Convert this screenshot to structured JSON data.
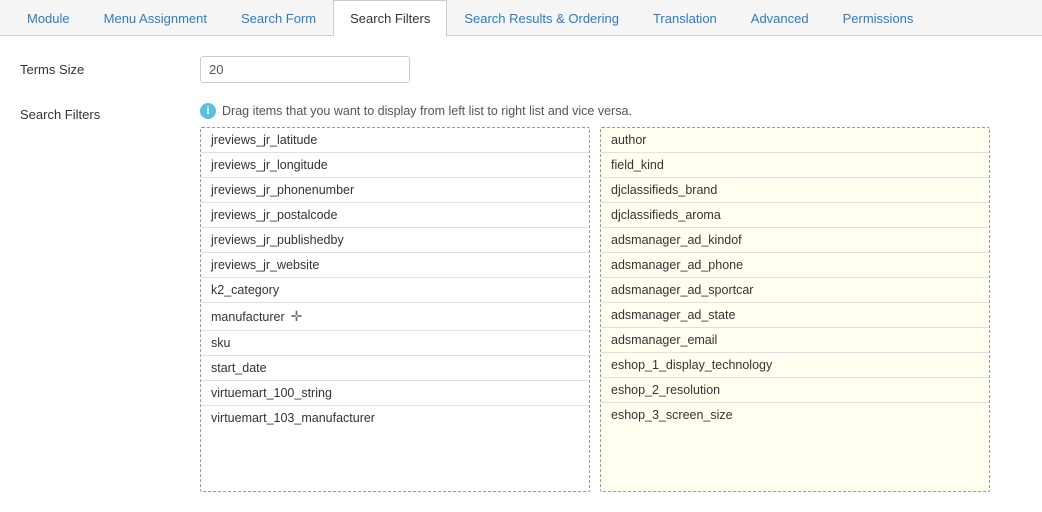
{
  "tabs": [
    {
      "id": "module",
      "label": "Module",
      "active": false
    },
    {
      "id": "menu-assignment",
      "label": "Menu Assignment",
      "active": false
    },
    {
      "id": "search-form",
      "label": "Search Form",
      "active": false
    },
    {
      "id": "search-filters",
      "label": "Search Filters",
      "active": true
    },
    {
      "id": "search-results-ordering",
      "label": "Search Results & Ordering",
      "active": false
    },
    {
      "id": "translation",
      "label": "Translation",
      "active": false
    },
    {
      "id": "advanced",
      "label": "Advanced",
      "active": false
    },
    {
      "id": "permissions",
      "label": "Permissions",
      "active": false
    }
  ],
  "terms_size": {
    "label": "Terms Size",
    "value": "20"
  },
  "search_filters": {
    "label": "Search Filters",
    "info_text": "Drag items that you want to display from left list to right list and vice versa.",
    "left_list": [
      "jreviews_jr_latitude",
      "jreviews_jr_longitude",
      "jreviews_jr_phonenumber",
      "jreviews_jr_postalcode",
      "jreviews_jr_publishedby",
      "jreviews_jr_website",
      "k2_category",
      "manufacturer",
      "sku",
      "start_date",
      "virtuemart_100_string",
      "virtuemart_103_manufacturer"
    ],
    "right_list": [
      "author",
      "field_kind",
      "djclassifieds_brand",
      "djclassifieds_aroma",
      "adsmanager_ad_kindof",
      "adsmanager_ad_phone",
      "adsmanager_ad_sportcar",
      "adsmanager_ad_state",
      "adsmanager_email",
      "eshop_1_display_technology",
      "eshop_2_resolution",
      "eshop_3_screen_size"
    ],
    "drag_item": "manufacturer",
    "drag_icon": "✛"
  }
}
